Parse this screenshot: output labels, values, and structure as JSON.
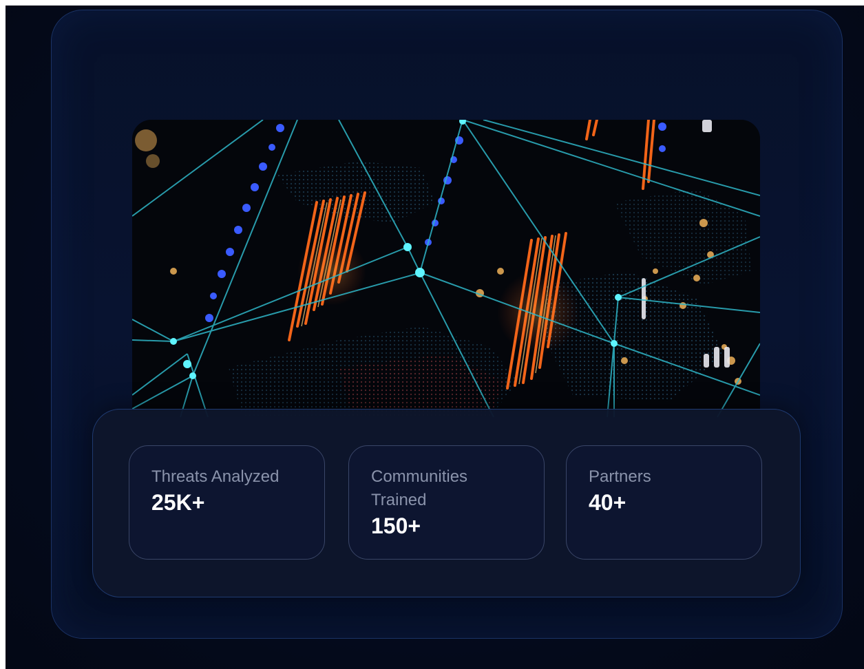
{
  "stats": [
    {
      "label": "Threats Analyzed",
      "value": "25K+"
    },
    {
      "label": "Communities Trained",
      "value": "150+"
    },
    {
      "label": "Partners",
      "value": "40+"
    }
  ],
  "colors": {
    "background": "#050b1e",
    "card_border": "#1b3366",
    "stat_border": "#3a4668",
    "label_text": "#8a93ab",
    "value_text": "#ffffff",
    "accent_orange": "#ff6a1a",
    "accent_cyan": "#2fd6e0",
    "accent_blue": "#3a5bff"
  },
  "hero_image": "network-data-visualization"
}
